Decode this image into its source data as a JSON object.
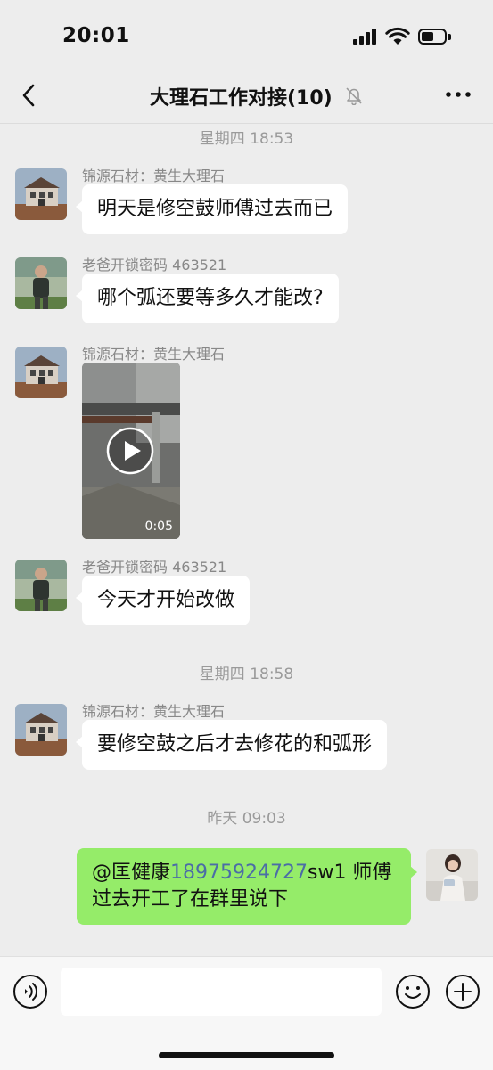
{
  "status_bar": {
    "time": "20:01"
  },
  "header": {
    "title": "大理石工作对接(10)",
    "muted_icon": "bell-slash-icon",
    "back_icon": "chevron-left-icon",
    "more_icon": "ellipsis-icon"
  },
  "messages": [
    {
      "type": "timestamp",
      "text": "星期四 18:53"
    },
    {
      "type": "text",
      "sender": "锦源石材：黄生大理石",
      "text": "明天是修空鼓师傅过去而已"
    },
    {
      "type": "text",
      "sender": "老爸开锁密码 463521",
      "text": "哪个弧还要等多久才能改?"
    },
    {
      "type": "video",
      "sender": "锦源石材：黄生大理石",
      "duration": "0:05"
    },
    {
      "type": "text",
      "sender": "老爸开锁密码 463521",
      "text": "今天才开始改做"
    },
    {
      "type": "timestamp",
      "text": "星期四 18:58"
    },
    {
      "type": "text",
      "sender": "锦源石材：黄生大理石",
      "text": "要修空鼓之后才去修花的和弧形"
    },
    {
      "type": "timestamp",
      "text": "昨天 09:03"
    },
    {
      "type": "outgoing",
      "mention": "@匡健康",
      "phone": "18975924727",
      "text": "sw1 师傅过去开工了在群里说下"
    }
  ],
  "input_bar": {
    "placeholder": "",
    "voice_icon": "voice-icon",
    "emoji_icon": "emoji-icon",
    "plus_icon": "plus-icon"
  },
  "colors": {
    "background": "#ededed",
    "outgoing_bubble": "#95ec69",
    "incoming_bubble": "#ffffff",
    "link": "#4b6da6"
  }
}
